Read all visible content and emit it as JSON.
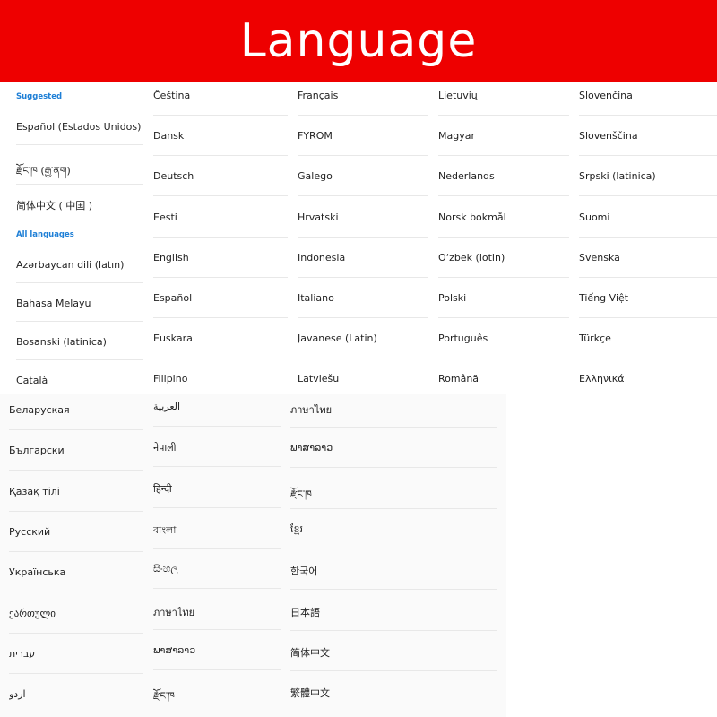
{
  "header": {
    "title": "Language"
  },
  "sidebar": {
    "suggested_label": "Suggested",
    "suggested": [
      "Español (Estados Unidos)",
      "རྫོང་ཁ (རྒྱ་ནག)",
      "简体中文 ( 中国 )"
    ],
    "all_label": "All languages",
    "all": [
      "Azərbaycan dili (latın)",
      "Bahasa Melayu",
      "Bosanski (latinica)",
      "Català"
    ]
  },
  "grid_top": {
    "col1": [
      "Čeština",
      "Dansk",
      "Deutsch",
      "Eesti",
      "English",
      "Español",
      "Euskara",
      "Filipino"
    ],
    "col2": [
      "Français",
      "FYROM",
      "Galego",
      "Hrvatski",
      "Indonesia",
      "Italiano",
      "Javanese (Latin)",
      "Latviešu"
    ],
    "col3": [
      "Lietuvių",
      "Magyar",
      "Nederlands",
      "Norsk bokmål",
      "O‘zbek (lotin)",
      "Polski",
      "Português",
      "Română"
    ],
    "col4": [
      "Slovenčina",
      "Slovenščina",
      "Srpski (latinica)",
      "Suomi",
      "Svenska",
      "Tiếng Việt",
      "Türkçe",
      "Ελληνικά"
    ]
  },
  "grid_bottom": {
    "col1": [
      "Беларуская",
      "Български",
      "Қазақ тілі",
      "Русский",
      "Українська",
      "ქართული",
      "עברית",
      "اردو"
    ],
    "col2": [
      "العربية",
      "नेपाली",
      "हिन्दी",
      "বাংলা",
      "සිංහල",
      "ภาษาไทย",
      "ພາສາລາວ",
      "རྫོང་ཁ"
    ],
    "col3": [
      "ภาษาไทย",
      "ພາສາລາວ",
      "རྫོང་ཁ",
      "ខ្មែរ",
      "한국어",
      "日本語",
      "简体中文",
      "繁體中文"
    ]
  },
  "colors": {
    "banner": "#ee0000",
    "section_heading": "#1e7fd6"
  }
}
